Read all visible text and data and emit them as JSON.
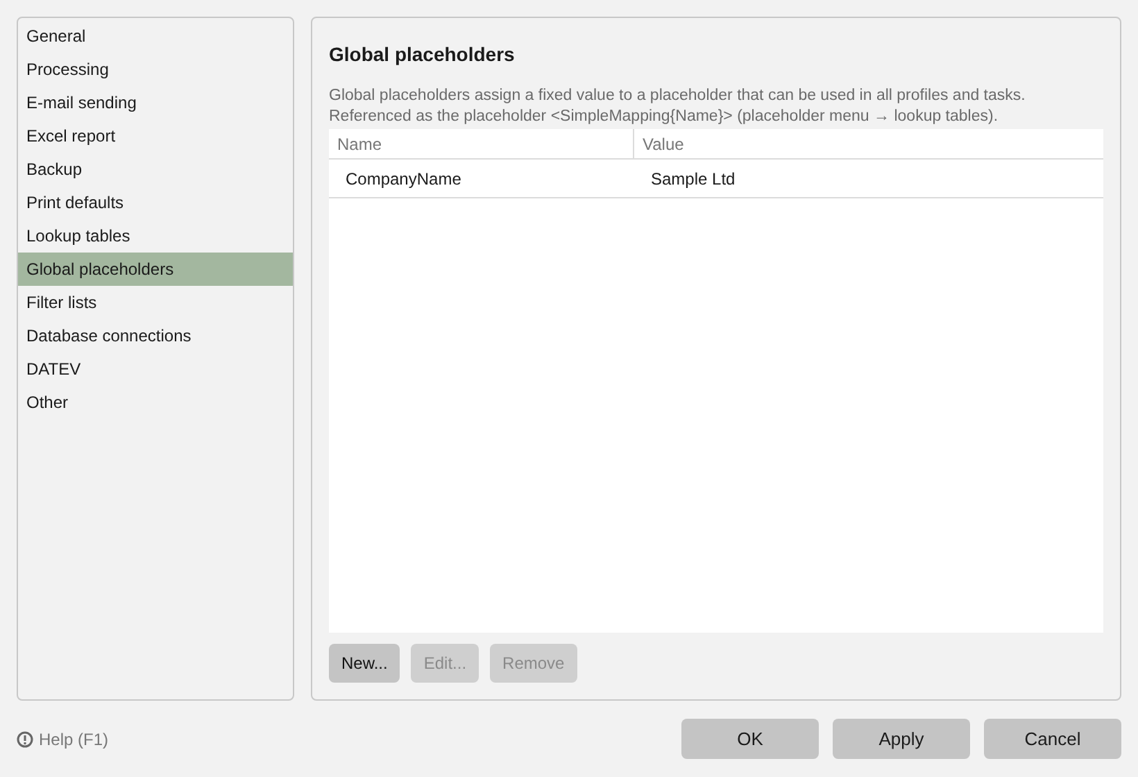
{
  "sidebar": {
    "items": [
      {
        "label": "General",
        "selected": false
      },
      {
        "label": "Processing",
        "selected": false
      },
      {
        "label": "E-mail sending",
        "selected": false
      },
      {
        "label": "Excel report",
        "selected": false
      },
      {
        "label": "Backup",
        "selected": false
      },
      {
        "label": "Print defaults",
        "selected": false
      },
      {
        "label": "Lookup tables",
        "selected": false
      },
      {
        "label": "Global placeholders",
        "selected": true
      },
      {
        "label": "Filter lists",
        "selected": false
      },
      {
        "label": "Database connections",
        "selected": false
      },
      {
        "label": "DATEV",
        "selected": false
      },
      {
        "label": "Other",
        "selected": false
      }
    ]
  },
  "panel": {
    "title": "Global placeholders",
    "description": [
      "Global placeholders assign a fixed value to a placeholder that can be used in all profiles and tasks.",
      "Referenced as the placeholder <SimpleMapping{Name}> (placeholder menu → lookup tables)."
    ],
    "table": {
      "columns": [
        "Name",
        "Value"
      ],
      "rows": [
        [
          "CompanyName",
          "Sample Ltd"
        ]
      ]
    },
    "buttons": [
      {
        "label": "New...",
        "disabled": false
      },
      {
        "label": "Edit...",
        "disabled": true
      },
      {
        "label": "Remove",
        "disabled": true
      }
    ]
  },
  "help": "Help (F1)",
  "buttons": [
    "OK",
    "Apply",
    "Cancel"
  ]
}
